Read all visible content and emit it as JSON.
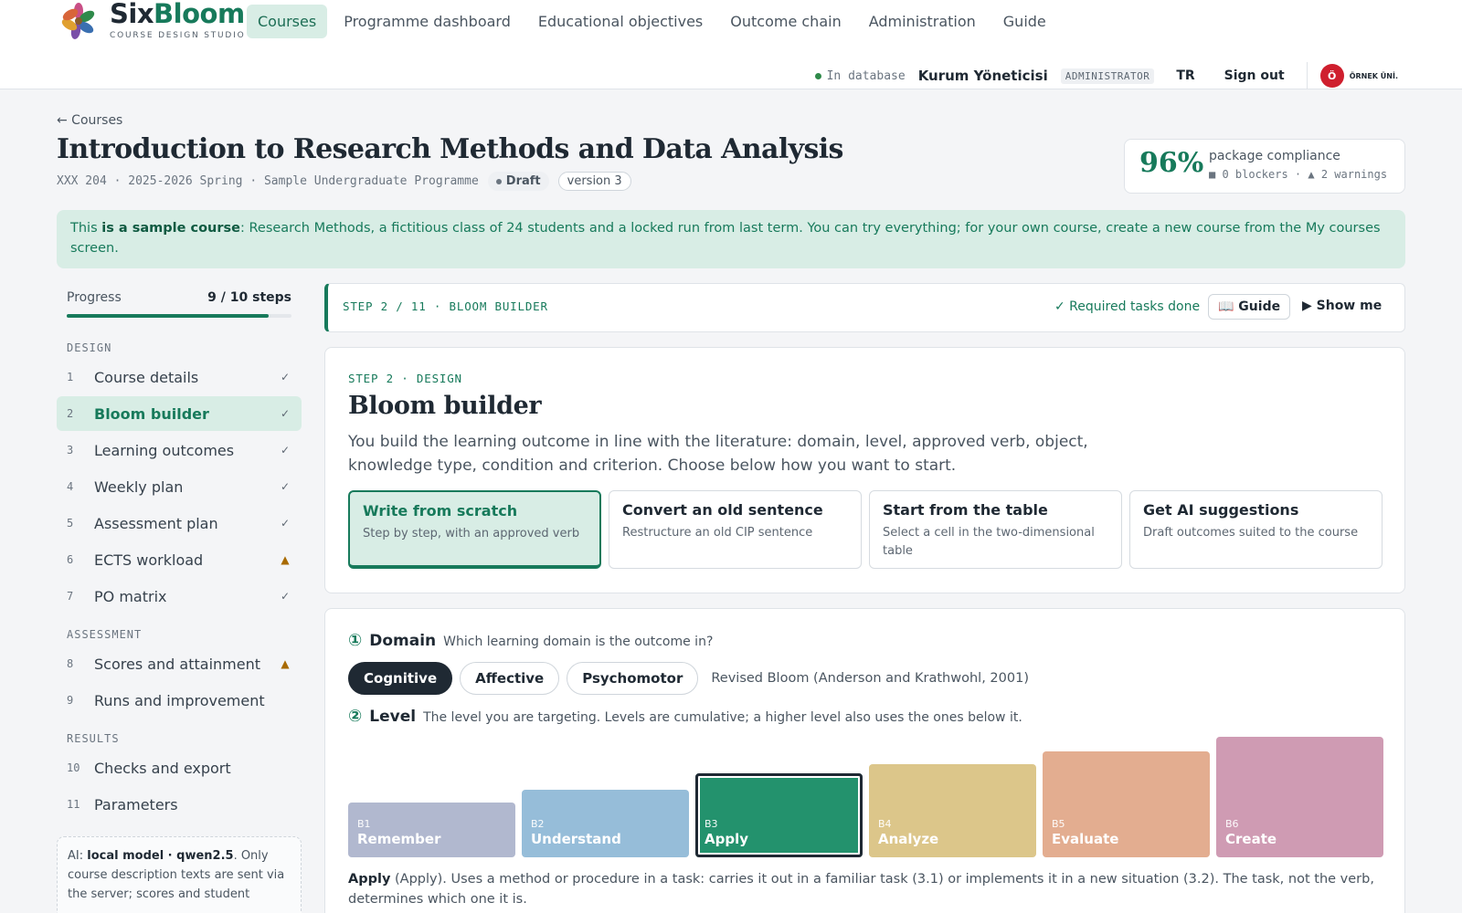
{
  "brand": {
    "name_part1": "Six",
    "name_part2": "Bloom",
    "subtitle": "COURSE DESIGN STUDIO"
  },
  "nav": {
    "items": [
      {
        "label": "Courses",
        "active": true
      },
      {
        "label": "Programme dashboard",
        "active": false
      },
      {
        "label": "Educational objectives",
        "active": false
      },
      {
        "label": "Outcome chain",
        "active": false
      },
      {
        "label": "Administration",
        "active": false
      },
      {
        "label": "Guide",
        "active": false
      }
    ]
  },
  "status": {
    "db_state": "In database",
    "user_name": "Kurum Yöneticisi",
    "role": "ADMINISTRATOR",
    "language": "TR",
    "signout": "Sign out",
    "university_seal": "Ö",
    "university_name": "ÖRNEK ÜNİ."
  },
  "header": {
    "back": "← Courses",
    "title": "Introduction to Research Methods and Data Analysis",
    "meta": "XXX 204 · 2025-2026 Spring · Sample Undergraduate Programme",
    "status": "Draft",
    "version": "version 3"
  },
  "compliance": {
    "percent": "96%",
    "label": "package compliance",
    "summary": "■ 0 blockers · ▲ 2 warnings"
  },
  "notice": {
    "prefix": "This ",
    "bold": "is a sample course",
    "rest": ": Research Methods, a fictitious class of 24 students and a locked run from last term. You can try everything; for your own course, create a new course from the My courses screen."
  },
  "sidebar": {
    "progress_label": "Progress",
    "progress_steps": "9 / 10 steps",
    "progress_fraction": 0.9,
    "sections": [
      {
        "label": "DESIGN",
        "items": [
          {
            "num": "1",
            "label": "Course details",
            "status": "✓",
            "active": false
          },
          {
            "num": "2",
            "label": "Bloom builder",
            "status": "✓",
            "active": true
          },
          {
            "num": "3",
            "label": "Learning outcomes",
            "status": "✓",
            "active": false
          },
          {
            "num": "4",
            "label": "Weekly plan",
            "status": "✓",
            "active": false
          },
          {
            "num": "5",
            "label": "Assessment plan",
            "status": "✓",
            "active": false
          },
          {
            "num": "6",
            "label": "ECTS workload",
            "status": "▲",
            "active": false
          },
          {
            "num": "7",
            "label": "PO matrix",
            "status": "✓",
            "active": false
          }
        ]
      },
      {
        "label": "ASSESSMENT",
        "items": [
          {
            "num": "8",
            "label": "Scores and attainment",
            "status": "▲",
            "active": false
          },
          {
            "num": "9",
            "label": "Runs and improvement",
            "status": "",
            "active": false
          }
        ]
      },
      {
        "label": "RESULTS",
        "items": [
          {
            "num": "10",
            "label": "Checks and export",
            "status": "",
            "active": false
          },
          {
            "num": "11",
            "label": "Parameters",
            "status": "",
            "active": false
          }
        ]
      }
    ],
    "ai_prefix": "AI: ",
    "ai_bold": "local model · qwen2.5",
    "ai_rest": ". Only course description texts are sent via the server; scores and student"
  },
  "stepbar": {
    "code": "STEP 2 / 11 · BLOOM BUILDER",
    "done": "✓ Required tasks done",
    "guide": "📖 Guide",
    "show_me": "▶ Show me"
  },
  "card": {
    "eyebrow": "STEP 2 · DESIGN",
    "title": "Bloom builder",
    "description": "You build the learning outcome in line with the literature: domain, level, approved verb, object, knowledge type, condition and criterion. Choose below how you want to start.",
    "options": [
      {
        "title": "Write from scratch",
        "desc": "Step by step, with an approved verb",
        "active": true
      },
      {
        "title": "Convert an old sentence",
        "desc": "Restructure an old CIP sentence",
        "active": false
      },
      {
        "title": "Start from the table",
        "desc": "Select a cell in the two-dimensional table",
        "active": false
      },
      {
        "title": "Get AI suggestions",
        "desc": "Draft outcomes suited to the course",
        "active": false
      }
    ]
  },
  "domain": {
    "num": "①",
    "title": "Domain",
    "hint": "Which learning domain is the outcome in?",
    "options": [
      {
        "label": "Cognitive",
        "active": true
      },
      {
        "label": "Affective",
        "active": false
      },
      {
        "label": "Psychomotor",
        "active": false
      }
    ],
    "reference": "Revised Bloom (Anderson and Krathwohl, 2001)"
  },
  "level": {
    "num": "②",
    "title": "Level",
    "hint": "The level you are targeting. Levels are cumulative; a higher level also uses the ones below it.",
    "levels": [
      {
        "code": "B1",
        "name": "Remember",
        "color": "#b1b8cf",
        "selected": false
      },
      {
        "code": "B2",
        "name": "Understand",
        "color": "#96bdd9",
        "selected": false
      },
      {
        "code": "B3",
        "name": "Apply",
        "color": "#23926d",
        "selected": true
      },
      {
        "code": "B4",
        "name": "Analyze",
        "color": "#dcc68a",
        "selected": false
      },
      {
        "code": "B5",
        "name": "Evaluate",
        "color": "#e3ad90",
        "selected": false
      },
      {
        "code": "B6",
        "name": "Create",
        "color": "#cf9bb3",
        "selected": false
      }
    ],
    "selected_name": "Apply",
    "selected_desc": " (Apply). Uses a method or procedure in a task: carries it out in a familiar task (3.1) or implements it in a new situation (3.2). The task, not the verb, determines which one it is."
  }
}
